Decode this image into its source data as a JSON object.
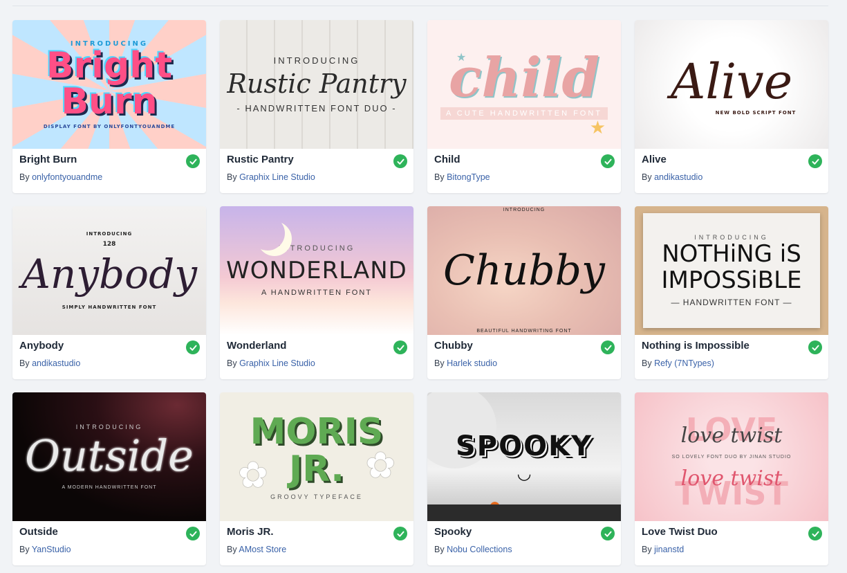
{
  "check_color": "#2eb35a",
  "by_prefix": "By",
  "fonts": [
    {
      "name": "Bright Burn",
      "author": "onlyfontyouandme",
      "art": {
        "intro": "INTRODUCING",
        "title": "Bright Burn",
        "sub": "DISPLAY FONT BY ONLYFONTYOUANDME"
      }
    },
    {
      "name": "Rustic Pantry",
      "author": "Graphix Line Studio",
      "art": {
        "intro": "INTRODUCING",
        "title": "Rustic Pantry",
        "sub": "- HANDWRITTEN FONT DUO -"
      }
    },
    {
      "name": "Child",
      "author": "BitongType",
      "art": {
        "intro": "",
        "title": "child",
        "sub": "A CUTE HANDWRITTEN FONT"
      }
    },
    {
      "name": "Alive",
      "author": "andikastudio",
      "art": {
        "intro": "",
        "title": "Alive",
        "sub": "NEW BOLD SCRIPT FONT"
      }
    },
    {
      "name": "Anybody",
      "author": "andikastudio",
      "art": {
        "intro": "INTRODUCING",
        "title": "Anybody",
        "sub": "SIMPLY HANDWRITTEN FONT",
        "extra": "128"
      }
    },
    {
      "name": "Wonderland",
      "author": "Graphix Line Studio",
      "art": {
        "intro": "INTRODUCING",
        "title": "WONDERLAND",
        "sub": "A HANDWRITTEN FONT"
      }
    },
    {
      "name": "Chubby",
      "author": "Harlek studio",
      "art": {
        "intro": "INTRODUCING",
        "title": "Chubby",
        "sub": "BEAUTIFUL HANDWRITING FONT"
      }
    },
    {
      "name": "Nothing is Impossible",
      "author": "Refy (7NTypes)",
      "art": {
        "intro": "INTRODUCING",
        "title": "NOTHiNG iS IMPOSSiBLE",
        "sub": "— HANDWRITTEN FONT —"
      }
    },
    {
      "name": "Outside",
      "author": "YanStudio",
      "art": {
        "intro": "INTRODUCING",
        "title": "Outside",
        "sub": "A MODERN HANDWRITTEN FONT"
      }
    },
    {
      "name": "Moris JR.",
      "author": "AMost Store",
      "art": {
        "intro": "",
        "title": "MORIS JR.",
        "sub": "GROOVY TYPEFACE"
      }
    },
    {
      "name": "Spooky",
      "author": "Nobu Collections",
      "art": {
        "intro": "",
        "title": "SPOOKY",
        "sub": ""
      }
    },
    {
      "name": "Love Twist Duo",
      "author": "jinanstd",
      "art": {
        "intro": "",
        "title": "love twist",
        "sub": "SO LOVELY FONT DUO BY JINAN STUDIO",
        "extra": "LOVE TWIST"
      }
    }
  ]
}
